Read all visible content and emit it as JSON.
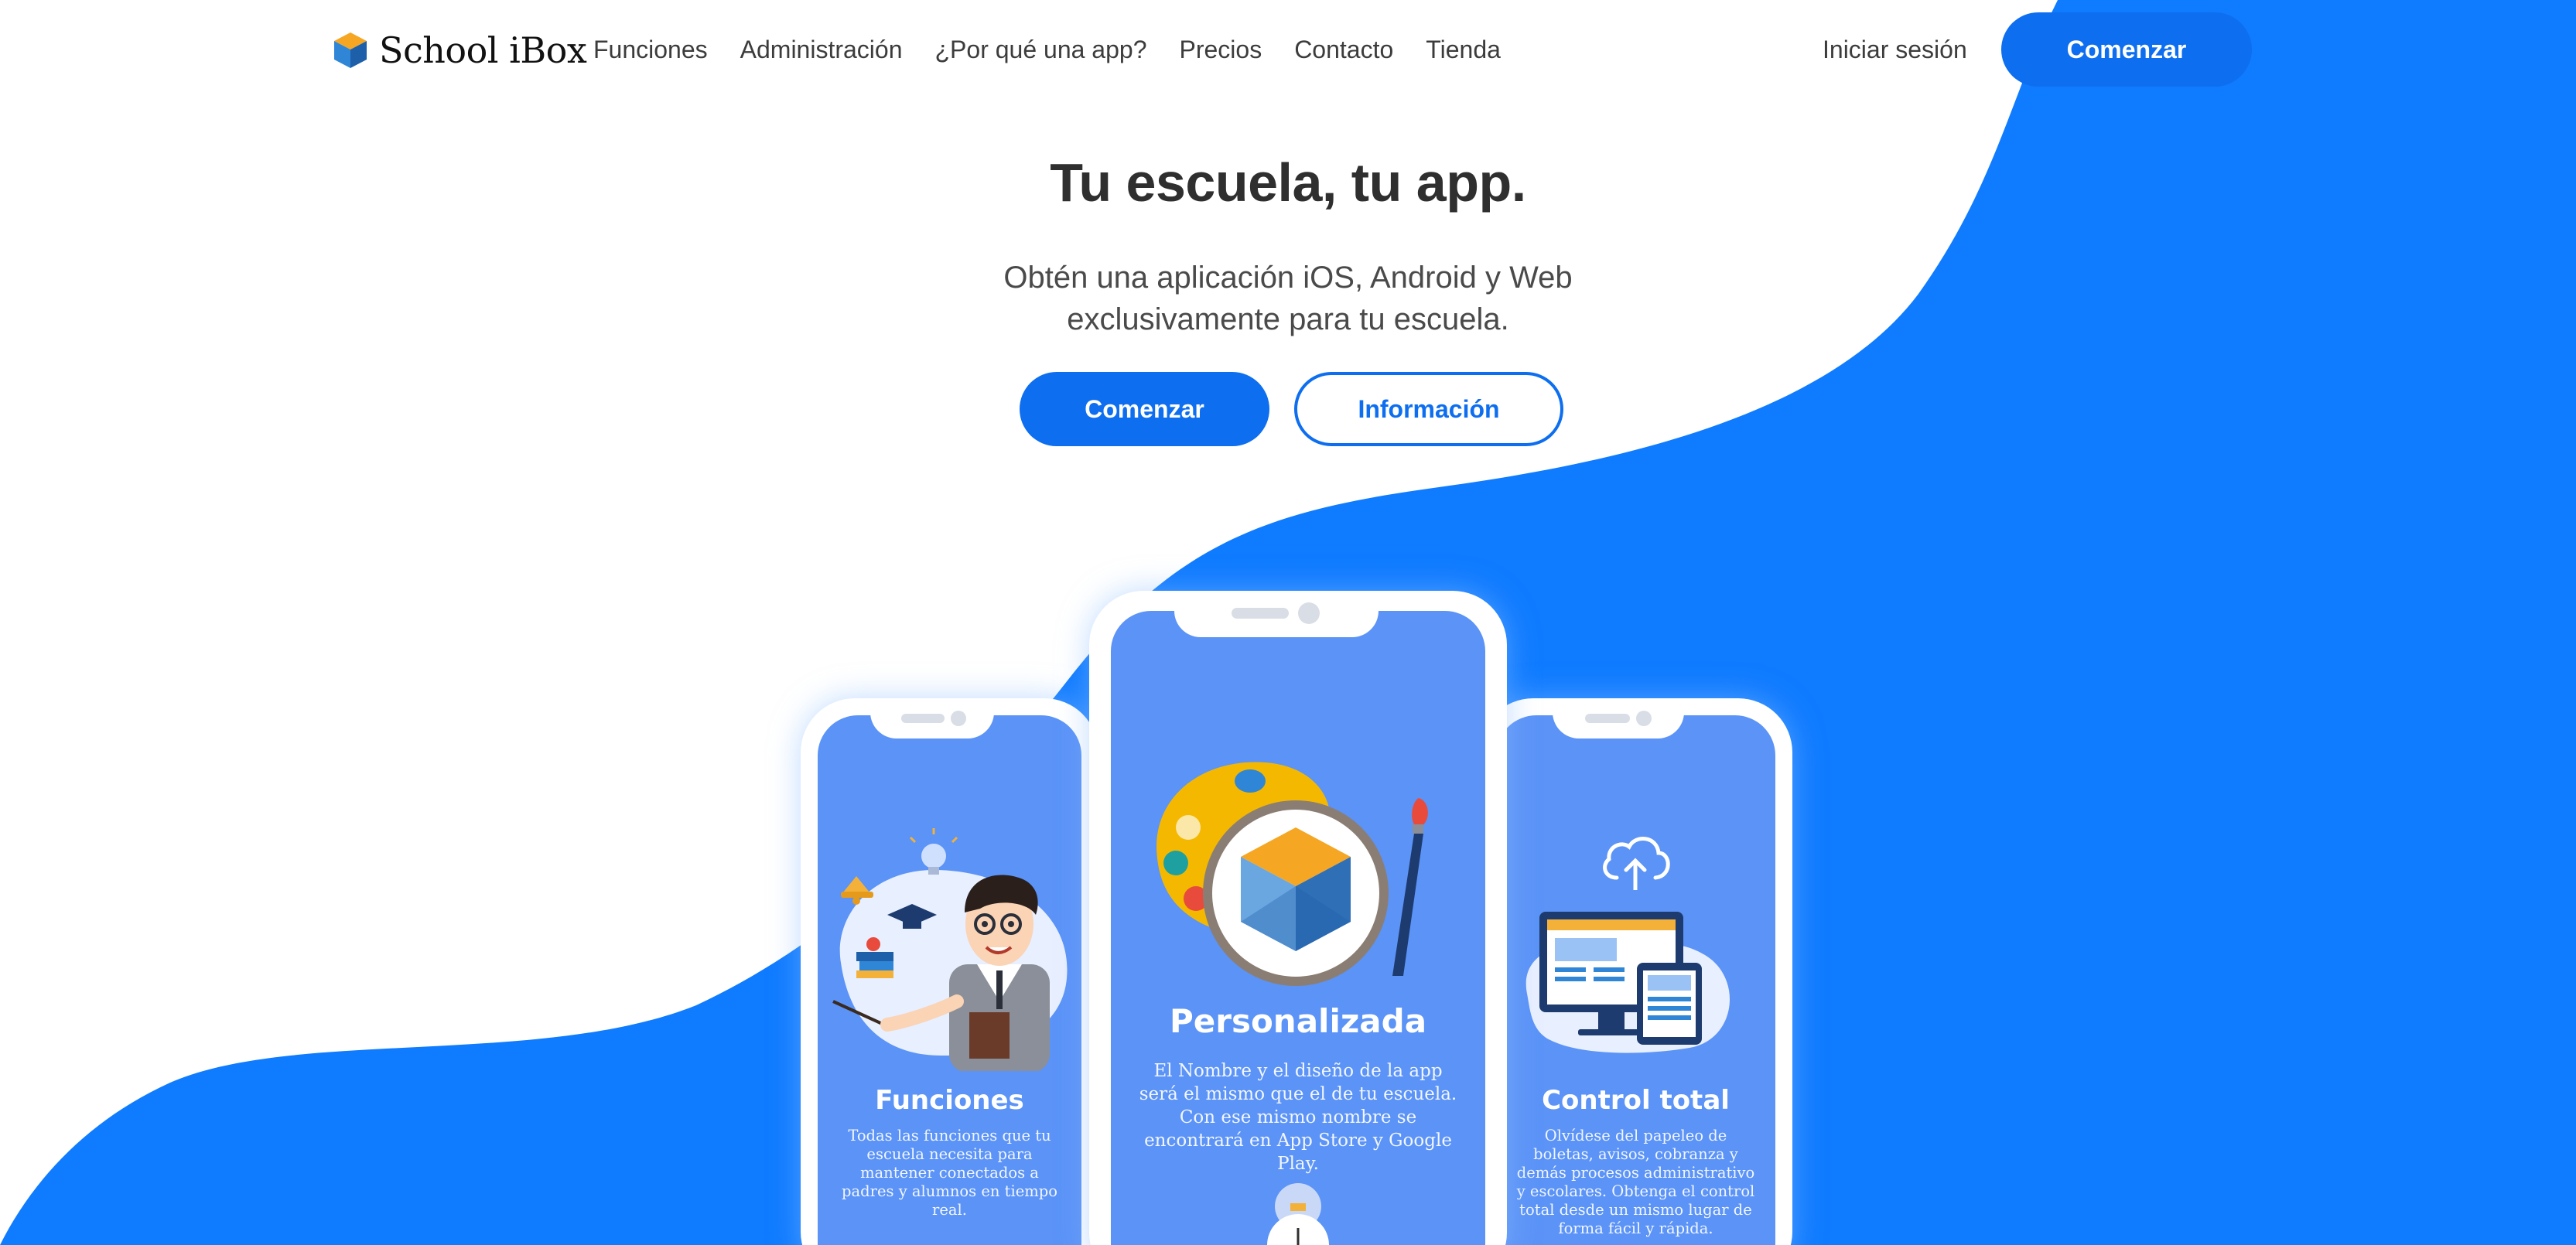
{
  "brand": {
    "name": "School iBox"
  },
  "nav": {
    "links": [
      "Funciones",
      "Administración",
      "¿Por qué una app?",
      "Precios",
      "Contacto",
      "Tienda"
    ],
    "login": "Iniciar sesión",
    "cta": "Comenzar"
  },
  "hero": {
    "title": "Tu escuela, tu app.",
    "subtitle": "Obtén una aplicación iOS, Android y Web exclusivamente para tu escuela.",
    "primary_button": "Comenzar",
    "secondary_button": "Información"
  },
  "phones": {
    "left": {
      "title": "Funciones",
      "text": "Todas las funciones que tu escuela necesita para mantener conectados a padres y alumnos en tiempo real."
    },
    "center": {
      "title": "Personalizada",
      "text": "El Nombre y el diseño de la app será el mismo que el de tu escuela. Con ese mismo nombre se encontrará en App Store y Google Play."
    },
    "right": {
      "title": "Control total",
      "text": "Olvídese del papeleo de boletas, avisos, cobranza y demás procesos administrativo y escolares. Obtenga el control total desde un mismo lugar de forma fácil y rápida."
    }
  },
  "colors": {
    "accent": "#0d6ef0",
    "wave": "#0f7bff",
    "screen": "#5b93f7",
    "text_dark": "#2f2f2f"
  },
  "icons": [
    "logo-cube-icon",
    "palette-icon",
    "brush-icon",
    "cloud-upload-icon",
    "monitor-icon",
    "tablet-icon",
    "teacher-illustration",
    "bell-icon",
    "lightbulb-icon",
    "graduation-cap-icon",
    "books-icon"
  ]
}
